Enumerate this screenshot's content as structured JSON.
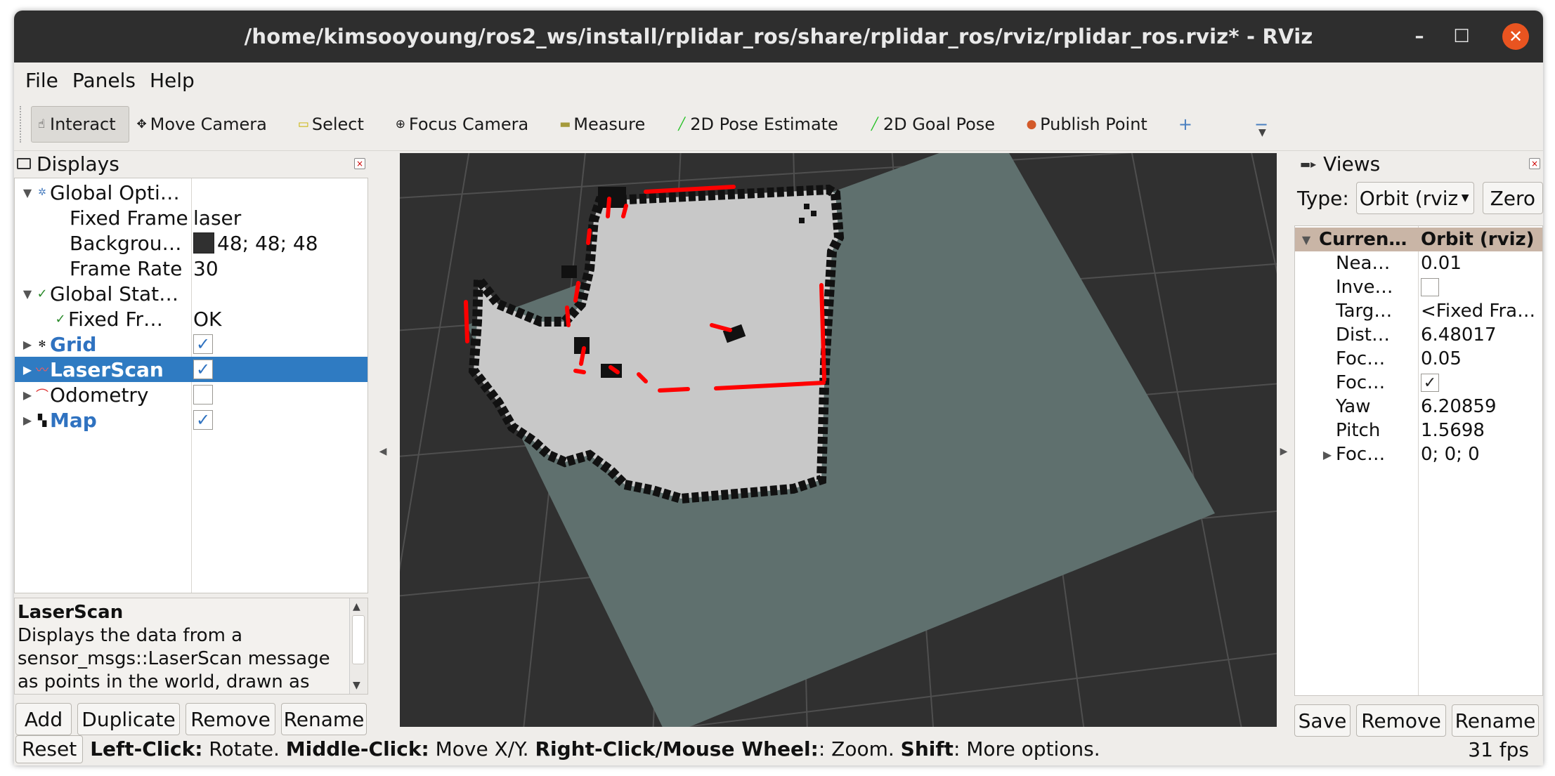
{
  "window": {
    "title": "/home/kimsooyoung/ros2_ws/install/rplidar_ros/share/rplidar_ros/rviz/rplidar_ros.rviz* - RViz",
    "controls": {
      "minimize": "–",
      "maximize": "☐",
      "close": "✕"
    }
  },
  "menu": {
    "file": "File",
    "panels": "Panels",
    "help": "Help"
  },
  "toolbar": {
    "interact": "Interact",
    "move_camera": "Move Camera",
    "select": "Select",
    "focus_camera": "Focus Camera",
    "measure": "Measure",
    "pose_estimate": "2D Pose Estimate",
    "goal_pose": "2D Goal Pose",
    "publish_point": "Publish Point",
    "add_tool": "+",
    "remove_tool": "−"
  },
  "displays": {
    "title": "Displays",
    "global_options": "Global Opti…",
    "fixed_frame_label": "Fixed Frame",
    "fixed_frame_value": "laser",
    "background_label": "Backgrou…",
    "background_value": "48; 48; 48",
    "background_color": "#303030",
    "frame_rate_label": "Frame Rate",
    "frame_rate_value": "30",
    "global_status": "Global Stat…",
    "fixed_frame_status_label": "Fixed Fr…",
    "fixed_frame_status_value": "OK",
    "items": [
      {
        "name": "Grid",
        "checked": true,
        "icon": "grid-icon"
      },
      {
        "name": "LaserScan",
        "checked": true,
        "icon": "laserscan-icon",
        "selected": true
      },
      {
        "name": "Odometry",
        "checked": false,
        "icon": "odometry-icon"
      },
      {
        "name": "Map",
        "checked": true,
        "icon": "map-icon"
      }
    ],
    "description_title": "LaserScan",
    "description_text": "Displays the data from a sensor_msgs::LaserScan message as points in the world, drawn as",
    "buttons": {
      "add": "Add",
      "duplicate": "Duplicate",
      "remove": "Remove",
      "rename": "Rename"
    }
  },
  "views": {
    "title": "Views",
    "type_label": "Type:",
    "type_value": "Orbit (rviz",
    "zero": "Zero",
    "current_label": "Curren…",
    "current_value": "Orbit (rviz)",
    "near_label": "Nea…",
    "near_value": "0.01",
    "invert_label": "Inve…",
    "invert_checked": false,
    "target_label": "Targ…",
    "target_value": "<Fixed Fra…",
    "distance_label": "Dist…",
    "distance_value": "6.48017",
    "focal_size_label": "Foc…",
    "focal_size_value": "0.05",
    "focal_shape_label": "Foc…",
    "focal_shape_checked": true,
    "yaw_label": "Yaw",
    "yaw_value": "6.20859",
    "pitch_label": "Pitch",
    "pitch_value": "1.5698",
    "focal_point_label": "Foc…",
    "focal_point_value": "0; 0; 0",
    "buttons": {
      "save": "Save",
      "remove": "Remove",
      "rename": "Rename"
    }
  },
  "status": {
    "reset": "Reset",
    "left_click": "Left-Click:",
    "rotate": " Rotate. ",
    "middle_click": "Middle-Click:",
    "move": " Move X/Y. ",
    "right_click": "Right-Click/Mouse Wheel:",
    "zoom": ": Zoom. ",
    "shift": "Shift",
    "more": ": More options.",
    "fps": "31 fps"
  },
  "colors": {
    "selection": "#2f7bc2",
    "scan_red": "#ff0000",
    "map_free": "#c8c8c8",
    "map_unknown": "#5f706e",
    "occupied": "#111111"
  }
}
